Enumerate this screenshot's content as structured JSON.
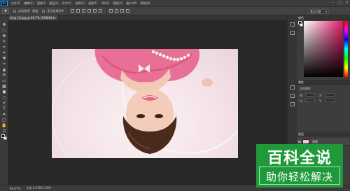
{
  "menubar": {
    "logo": "Ps",
    "items": [
      "文件(F)",
      "编辑(E)",
      "图像(I)",
      "图层(L)",
      "文字(Y)",
      "选择(S)",
      "滤镜(T)",
      "3D(D)",
      "视图(V)",
      "窗口(W)",
      "帮助(H)"
    ]
  },
  "options": {
    "tool_glyph": "✥",
    "auto_select_label": "自动选择:",
    "auto_select_target": "图层",
    "transform_label": "显示变换控件",
    "workspace": "基本功能"
  },
  "document": {
    "tab_title": "timg (1).jpg @ 66.7% (RGB/8#)"
  },
  "panels": {
    "color_tab": "颜色",
    "properties_tab": "属性",
    "properties_sub": "文档属性",
    "w_label": "W:",
    "h_label": "H:",
    "x_label": "X:",
    "y_label": "Y:",
    "layers_tab": "图层",
    "layer_name": "背景"
  },
  "status": {
    "zoom": "66.67%",
    "doc_info": "文档:1.01M/1.01M"
  },
  "watermark": {
    "line1": "百科全说",
    "line2": "助你轻松解决"
  },
  "colors": {
    "ps_blue": "#31a8ff",
    "watermark_green": "#1f9a3a",
    "pink": "#e4196a"
  }
}
